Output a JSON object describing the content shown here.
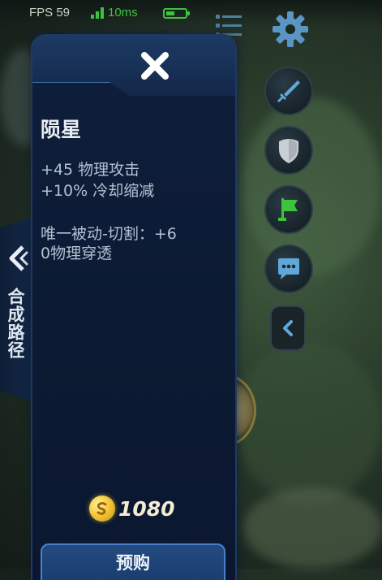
{
  "status": {
    "fps": "FPS 59",
    "ping": "10ms"
  },
  "colors": {
    "panel_bg": "#0f1f3b",
    "accent_blue": "#4a80c8",
    "ping_green": "#3ec33e",
    "coin_gold": "#f6c83a"
  },
  "right_buttons": [
    "sword-icon",
    "shield-icon",
    "flag-icon",
    "chat-bubble-icon",
    "collapse-arrow-icon"
  ],
  "synthesis_tab": {
    "label": "合成路径"
  },
  "item": {
    "name": "陨星",
    "stats": [
      "+45 物理攻击",
      "+10% 冷却缩减"
    ],
    "passive_line1": "唯一被动-切割：+6",
    "passive_line2": "0物理穿透",
    "price": "1080"
  },
  "buy_button": {
    "label": "预购"
  }
}
